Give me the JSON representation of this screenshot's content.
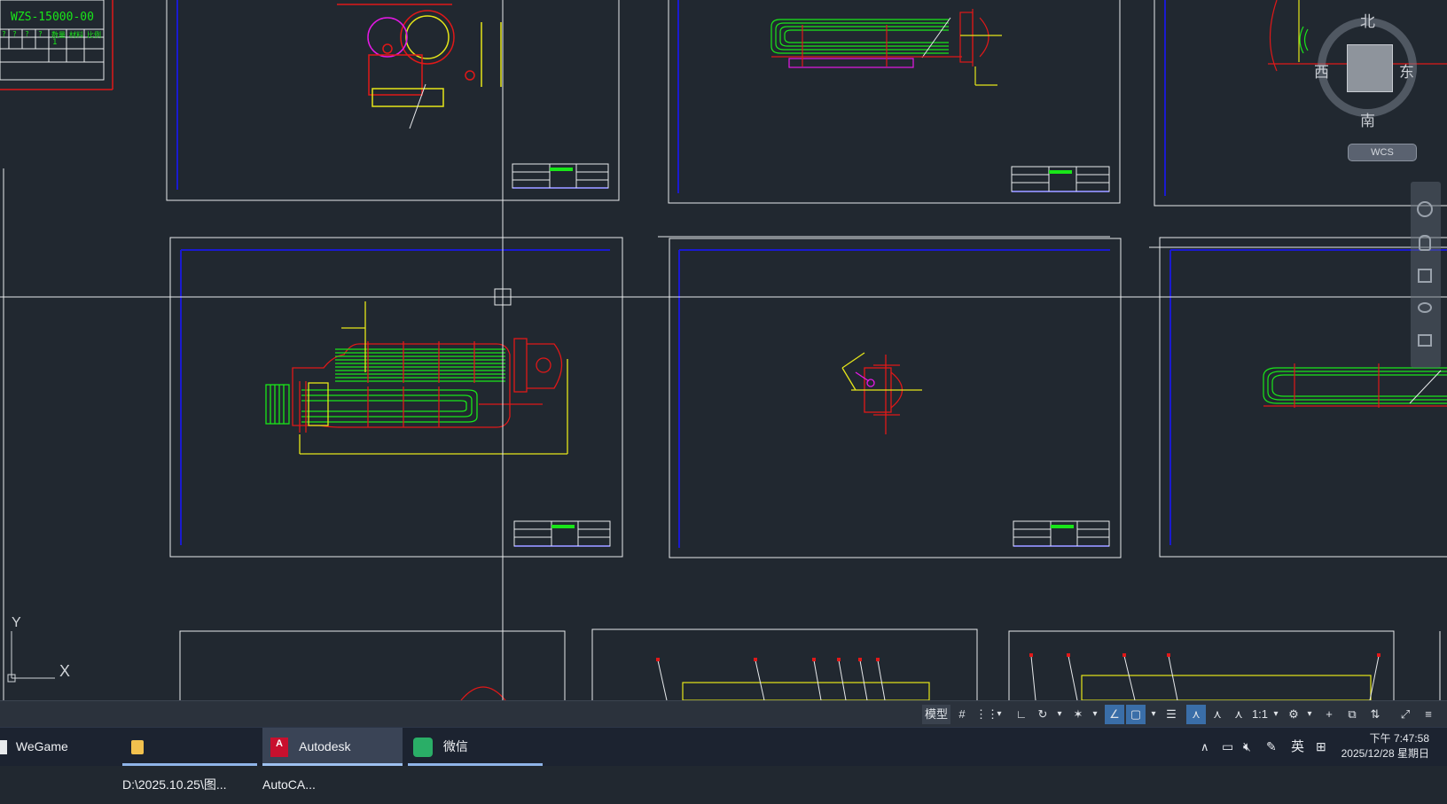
{
  "drawing": {
    "titleblock_code": "WZS-15000-00",
    "titleblock_row_labels": [
      "?",
      "?",
      "?",
      "?",
      "数量",
      "材料",
      "比例"
    ],
    "titleblock_qty": "1"
  },
  "viewcube": {
    "north": "北",
    "south": "南",
    "east": "东",
    "west": "西",
    "wcs_label": "WCS"
  },
  "ucs": {
    "y_label": "Y",
    "x_label": "X"
  },
  "statusbar": {
    "model_tab": "模型",
    "scale": "1:1"
  },
  "taskbar": {
    "apps": [
      {
        "label": "WeGame",
        "icon": "wegame-icon"
      },
      {
        "label": "D:\\2025.10.25\\图...",
        "icon": "folder-icon"
      },
      {
        "label": "Autodesk AutoCA...",
        "icon": "autocad-icon"
      },
      {
        "label": "微信",
        "icon": "wechat-icon"
      }
    ],
    "ime": "英",
    "time": "下午 7:47:58",
    "date": "2025/12/28 星期日"
  },
  "colors": {
    "background": "#212830",
    "red": "#e01818",
    "green": "#19e619",
    "yellow": "#e6e619",
    "magenta": "#e619e6",
    "blue": "#1a1ad0",
    "white": "#e8eaec"
  }
}
